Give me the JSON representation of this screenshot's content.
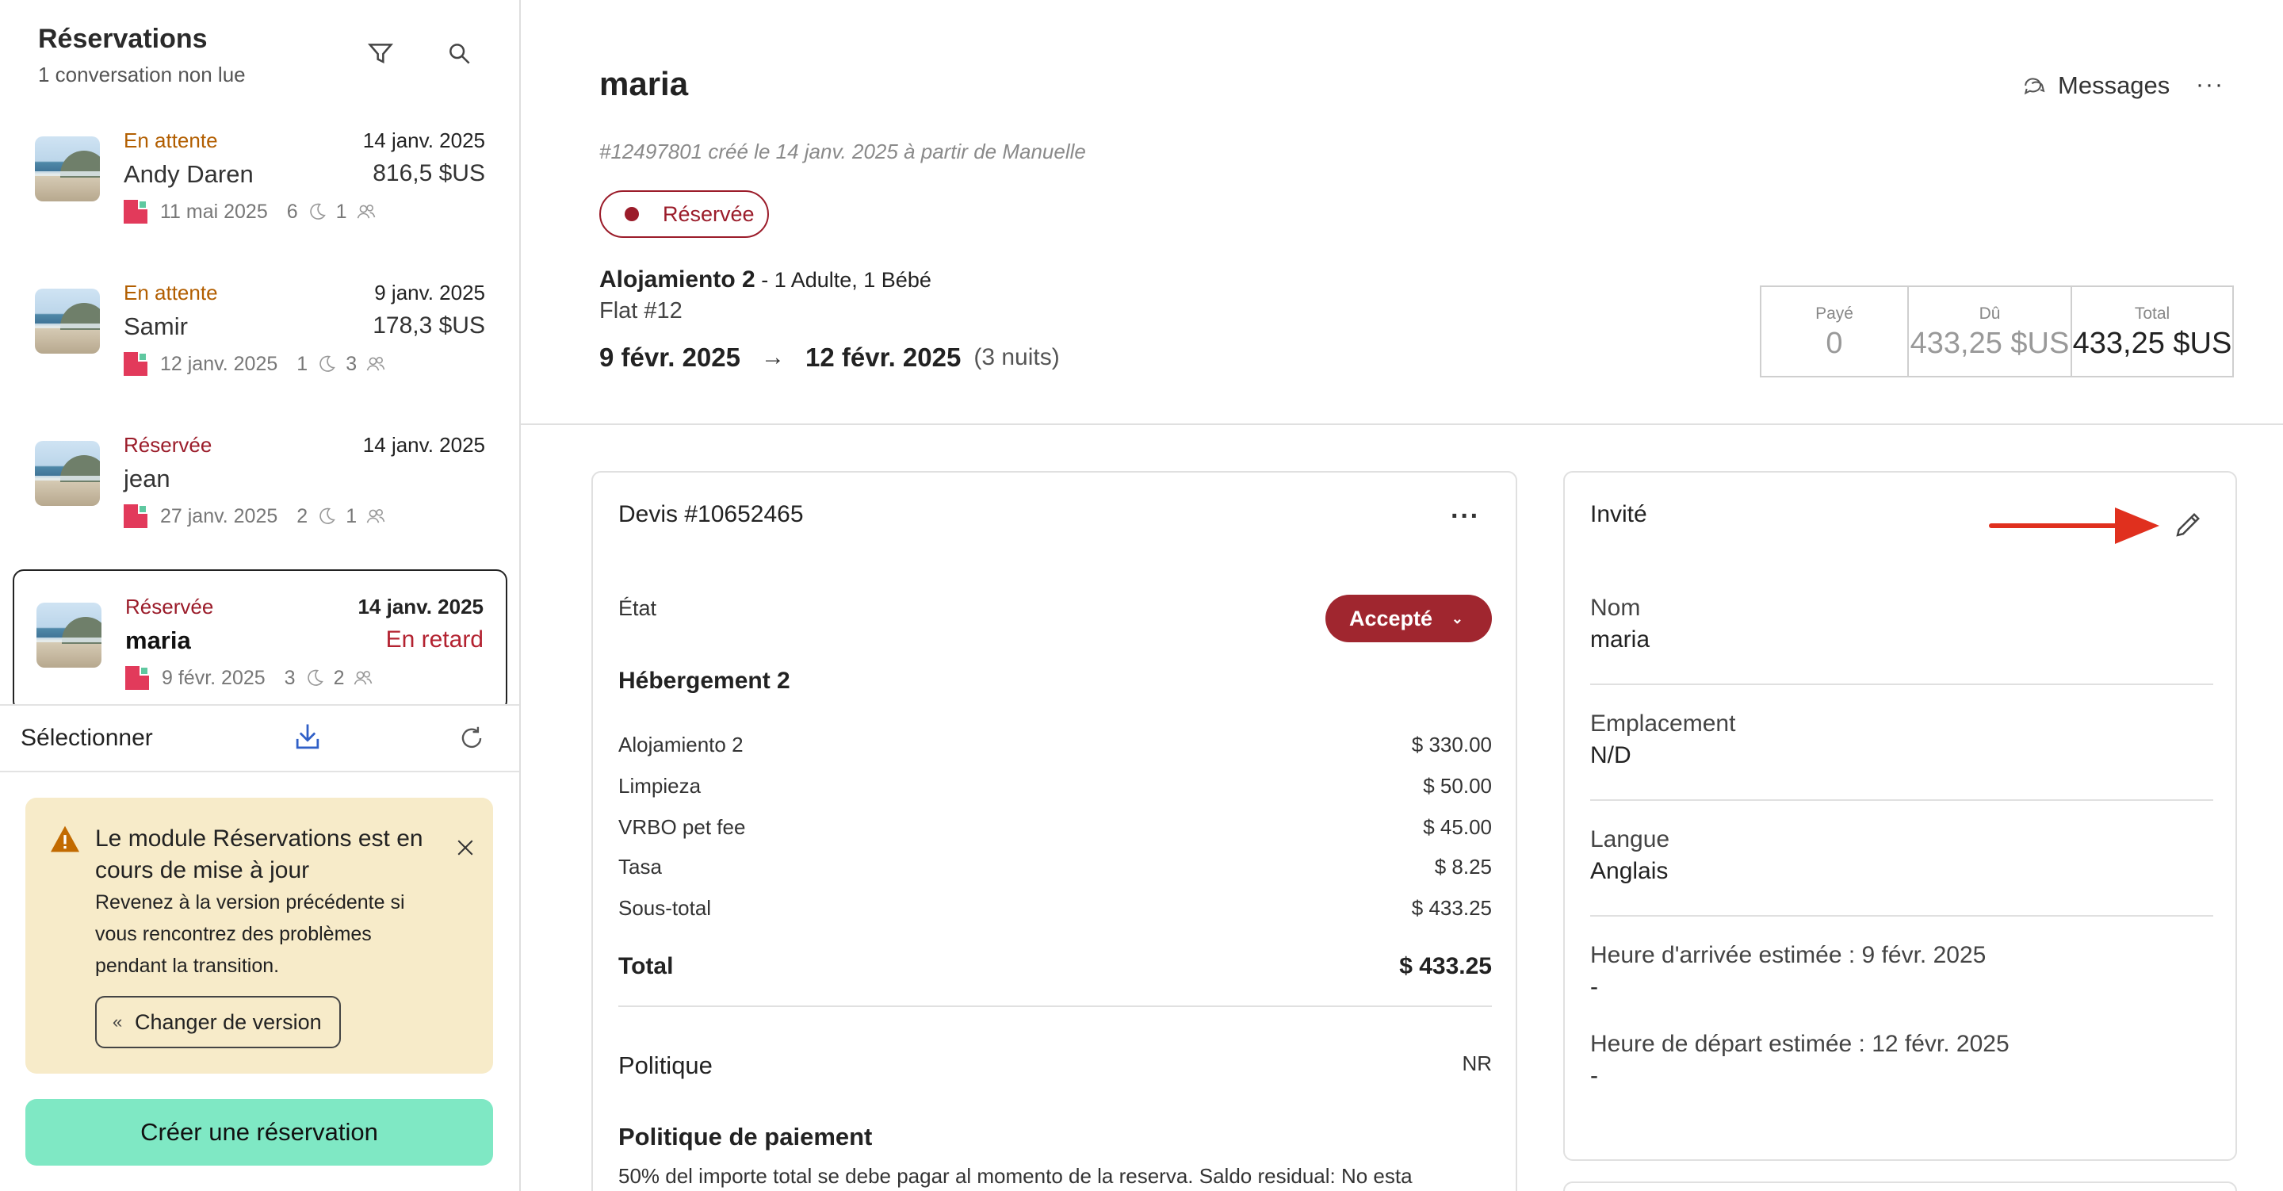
{
  "sidebar": {
    "title": "Réservations",
    "subtitle": "1 conversation non lue",
    "filter_icon": "filter-icon",
    "search_icon": "search-icon",
    "reservations": [
      {
        "status": "En attente",
        "date": "14 janv. 2025",
        "name": "Andy Daren",
        "amount": "816,5 $US",
        "checkin": "11 mai 2025",
        "nights": "6",
        "guests": "1"
      },
      {
        "status": "En attente",
        "date": "9 janv. 2025",
        "name": "Samir",
        "amount": "178,3 $US",
        "checkin": "12 janv. 2025",
        "nights": "1",
        "guests": "3"
      },
      {
        "status": "Réservée",
        "date": "14 janv. 2025",
        "name": "jean",
        "amount": "",
        "checkin": "27 janv. 2025",
        "nights": "2",
        "guests": "1"
      },
      {
        "status": "Réservée",
        "date": "14 janv. 2025",
        "name": "maria",
        "amount": "En retard",
        "checkin": "9 févr. 2025",
        "nights": "3",
        "guests": "2"
      }
    ],
    "toolbar": {
      "select_label": "Sélectionner"
    },
    "warning": {
      "title": "Le module Réservations est en cours de mise à jour",
      "body": "Revenez à la version précédente si vous rencontrez des problèmes pendant la transition.",
      "button": "Changer de version"
    },
    "create_button": "Créer une réservation"
  },
  "header": {
    "guest_name": "maria",
    "messages_label": "Messages",
    "more_label": "···",
    "info": "#12497801 créé le 14 janv. 2025 à partir de Manuelle",
    "status": "Réservée",
    "room": "Alojamiento 2",
    "guests": " - 1 Adulte, 1 Bébé",
    "flat": "Flat #12",
    "checkin": "9 févr. 2025",
    "arrow": "→",
    "checkout": "12 févr. 2025",
    "nights": "(3 nuits)",
    "payment": {
      "paid_label": "Payé",
      "paid_value": "0",
      "due_label": "Dû",
      "due_value": "433,25 $US",
      "total_label": "Total",
      "total_value": "433,25 $US"
    }
  },
  "quote": {
    "title": "Devis #10652465",
    "more_label": "···",
    "state_label": "État",
    "state_value": "Accepté",
    "section": "Hébergement 2",
    "rows": [
      {
        "label": "Alojamiento 2",
        "value": "$ 330.00"
      },
      {
        "label": "Limpieza",
        "value": "$ 50.00"
      },
      {
        "label": "VRBO pet fee",
        "value": "$ 45.00"
      },
      {
        "label": "Tasa",
        "value": "$ 8.25"
      },
      {
        "label": "Sous-total",
        "value": "$ 433.25"
      }
    ],
    "total_label": "Total",
    "total_value": "$ 433.25",
    "policy_label": "Politique",
    "policy_value": "NR",
    "payment_policy_title": "Politique de paiement",
    "payment_policy_text": "50% del importe total se debe pagar al momento de la reserva. Saldo residual: No esta"
  },
  "guest": {
    "title": "Invité",
    "fields": [
      {
        "label": "Nom",
        "value": "maria"
      },
      {
        "label": "Emplacement",
        "value": "N/D"
      },
      {
        "label": "Langue",
        "value": "Anglais"
      },
      {
        "label": "Heure d'arrivée estimée : 9 févr. 2025",
        "value": "-"
      },
      {
        "label": "Heure de départ estimée : 12 févr. 2025",
        "value": "-"
      }
    ]
  },
  "colors": {
    "booked": "#9b1c2a",
    "pending": "#b25e00",
    "accent_green": "#7fe8c4",
    "warning_bg": "#f7ebc9",
    "annotation_arrow": "#e0301e"
  }
}
